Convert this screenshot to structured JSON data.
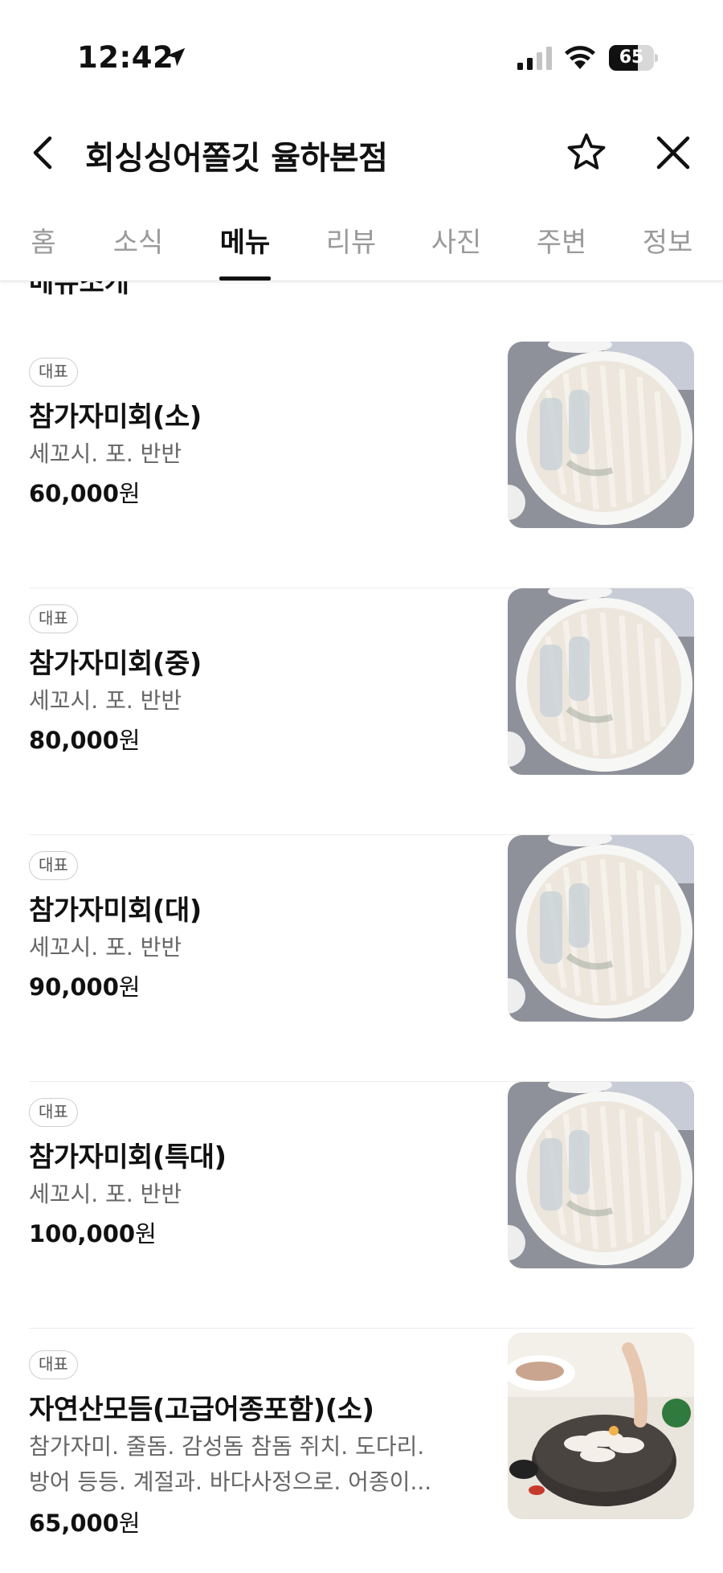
{
  "status_bar": {
    "time": "12:42",
    "battery": "65"
  },
  "header": {
    "title": "회싱싱어쫄깃 율하본점"
  },
  "tabs": [
    {
      "label": "홈",
      "active": false
    },
    {
      "label": "소식",
      "active": false
    },
    {
      "label": "메뉴",
      "active": true
    },
    {
      "label": "리뷰",
      "active": false
    },
    {
      "label": "사진",
      "active": false
    },
    {
      "label": "주변",
      "active": false
    },
    {
      "label": "정보",
      "active": false
    }
  ],
  "section_title": "메뉴소개",
  "menu_items": [
    {
      "badge": "대표",
      "name": "참가자미회(소)",
      "desc": "세꼬시. 포. 반반",
      "price": "60,000",
      "currency": "원",
      "image": "flounder-sashimi-plate"
    },
    {
      "badge": "대표",
      "name": "참가자미회(중)",
      "desc": "세꼬시. 포. 반반",
      "price": "80,000",
      "currency": "원",
      "image": "flounder-sashimi-plate"
    },
    {
      "badge": "대표",
      "name": "참가자미회(대)",
      "desc": "세꼬시. 포. 반반",
      "price": "90,000",
      "currency": "원",
      "image": "flounder-sashimi-plate"
    },
    {
      "badge": "대표",
      "name": "참가자미회(특대)",
      "desc": "세꼬시. 포. 반반",
      "price": "100,000",
      "currency": "원",
      "image": "flounder-sashimi-plate"
    },
    {
      "badge": "대표",
      "name": "자연산모듬(고급어종포함)(소)",
      "desc_line1": "참가자미. 줄돔. 감성돔 참돔 쥐치. 도다리.",
      "desc_line2": "방어 등등. 계절과. 바다사정으로. 어종이...",
      "price": "65,000",
      "currency": "원",
      "image": "assorted-sashimi-platter"
    }
  ]
}
